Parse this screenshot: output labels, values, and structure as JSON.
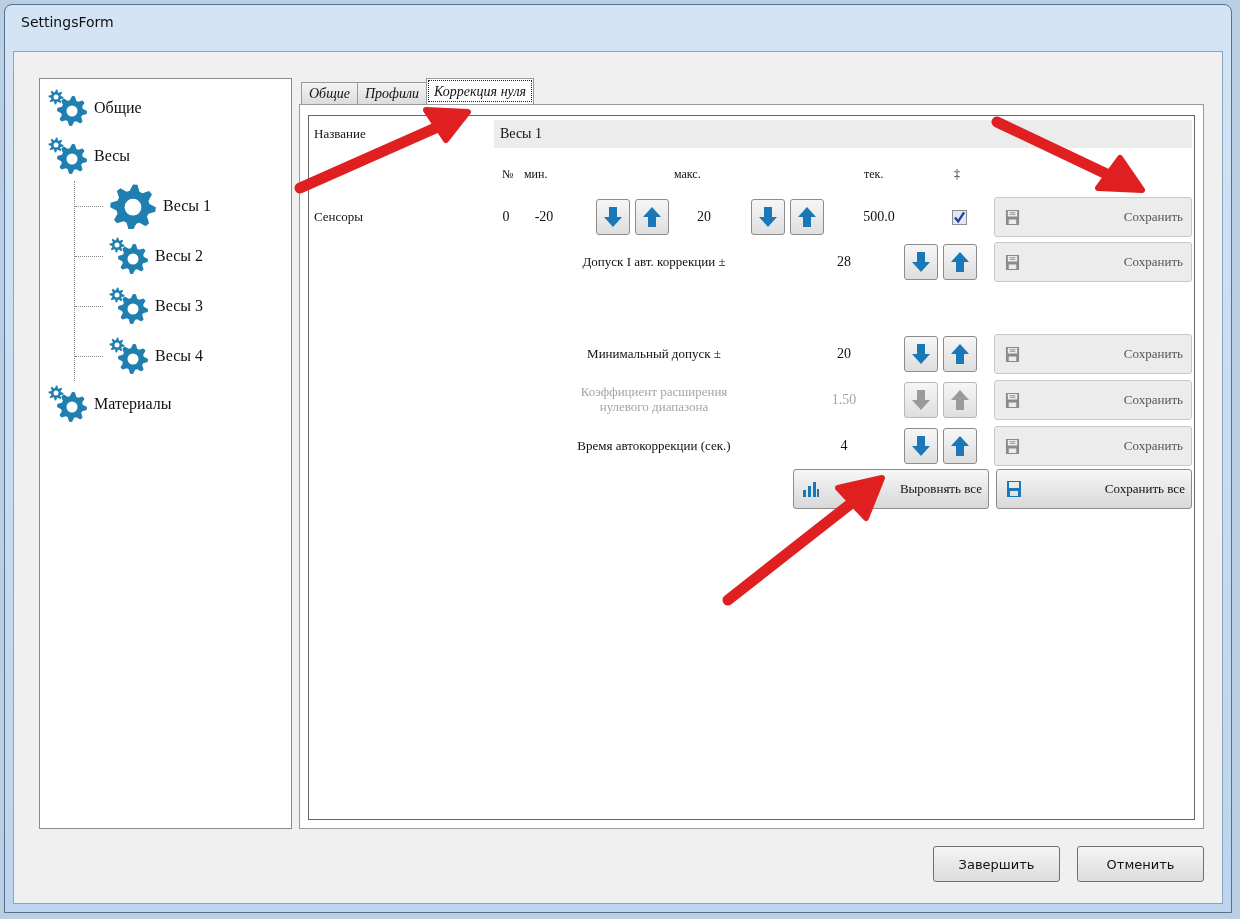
{
  "window": {
    "title": "SettingsForm"
  },
  "tree": [
    {
      "label": "Общие",
      "selected": false
    },
    {
      "label": "Весы",
      "selected": false,
      "children": [
        {
          "label": "Весы 1",
          "selected": true
        },
        {
          "label": "Весы 2",
          "selected": false
        },
        {
          "label": "Весы 3",
          "selected": false
        },
        {
          "label": "Весы 4",
          "selected": false
        }
      ]
    },
    {
      "label": "Материалы",
      "selected": false
    }
  ],
  "tabs": [
    {
      "label": "Общие",
      "selected": false
    },
    {
      "label": "Профили",
      "selected": false
    },
    {
      "label": "Коррекция нуля",
      "selected": true
    }
  ],
  "name": {
    "label": "Название",
    "value": "Весы 1"
  },
  "sensors": {
    "label": "Сенсоры",
    "columns": [
      "№",
      "мин.",
      "макс.",
      "тек.",
      "‡"
    ],
    "rows": [
      {
        "number": "0",
        "min": "-20",
        "max": "20",
        "current": "500.0",
        "checked": true,
        "save_label": "Сохранить"
      }
    ]
  },
  "settings": [
    {
      "label": "Допуск I авт. коррекции ±",
      "value": "28",
      "disabled": false,
      "save_label": "Сохранить"
    },
    {
      "label": "Минимальный допуск  ±",
      "value": "20",
      "disabled": false,
      "save_label": "Сохранить"
    },
    {
      "label": "Коэффициент расширения\nнулевого диапазона",
      "value": "1.50",
      "disabled": true,
      "save_label": "Сохранить"
    },
    {
      "label": "Время автокоррекции (сек.)",
      "value": "4",
      "disabled": false,
      "save_label": "Сохранить"
    }
  ],
  "actions": [
    {
      "label": "Выровнять все",
      "kind": "align"
    },
    {
      "label": "Сохранить все",
      "kind": "save"
    }
  ],
  "buttons": [
    "Завершить",
    "Отменить"
  ]
}
